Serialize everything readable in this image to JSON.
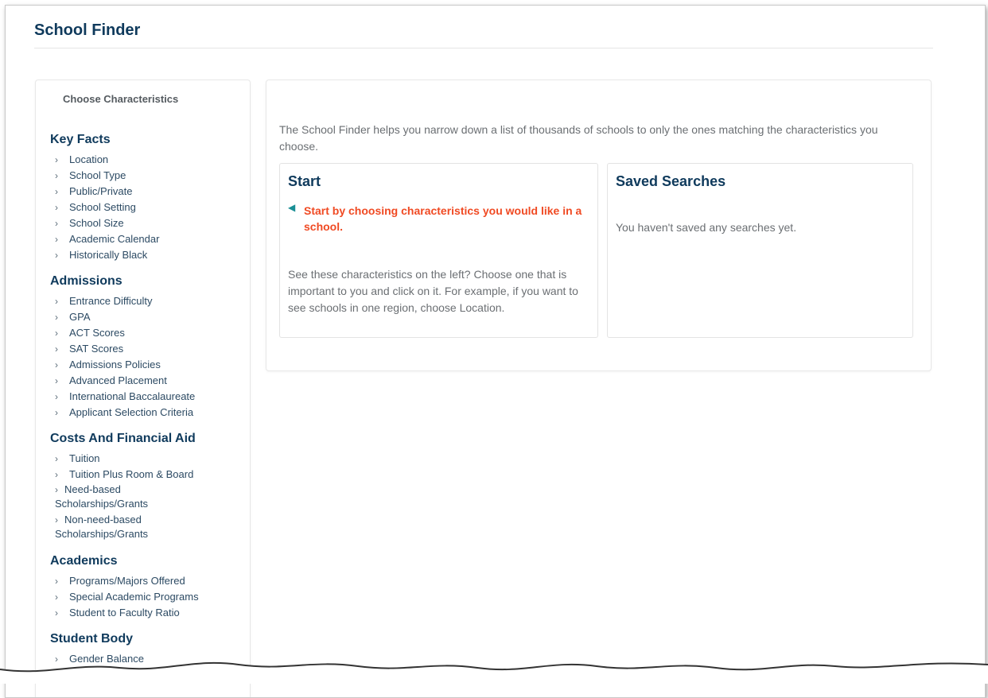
{
  "page": {
    "title": "School Finder"
  },
  "sidebar": {
    "heading": "Choose Characteristics",
    "categories": [
      {
        "title": "Key Facts",
        "items": [
          "Location",
          "School Type",
          "Public/Private",
          "School Setting",
          "School Size",
          "Academic Calendar",
          "Historically Black"
        ]
      },
      {
        "title": "Admissions",
        "items": [
          "Entrance Difficulty",
          "GPA",
          "ACT Scores",
          "SAT Scores",
          "Admissions Policies",
          "Advanced Placement",
          "International Baccalaureate",
          "Applicant Selection Criteria"
        ]
      },
      {
        "title": "Costs And Financial Aid",
        "items": [
          "Tuition",
          "Tuition Plus Room & Board",
          "Need-based Scholarships/Grants",
          "Non-need-based Scholarships/Grants"
        ]
      },
      {
        "title": "Academics",
        "items": [
          "Programs/Majors Offered",
          "Special Academic Programs",
          "Student to Faculty Ratio"
        ]
      },
      {
        "title": "Student Body",
        "items": [
          "Gender Balance"
        ]
      }
    ]
  },
  "main": {
    "intro": "The School Finder helps you narrow down a list of thousands of schools to only the ones matching the characteristics you choose.",
    "start": {
      "title": "Start",
      "callout": "Start by choosing characteristics you would like in a school.",
      "body": "See these characteristics on the left? Choose one that is important to you and click on it. For example, if you want to see schools in one region, choose Location."
    },
    "saved": {
      "title": "Saved Searches",
      "body": "You haven't saved any searches yet."
    }
  },
  "icons": {
    "chevron": "chevron-right-icon",
    "pointer": "arrow-left-icon"
  },
  "colors": {
    "heading": "#0f3a5c",
    "accent": "#f04a23",
    "pointer": "#1a8f95",
    "body_text": "#6b6f73"
  }
}
